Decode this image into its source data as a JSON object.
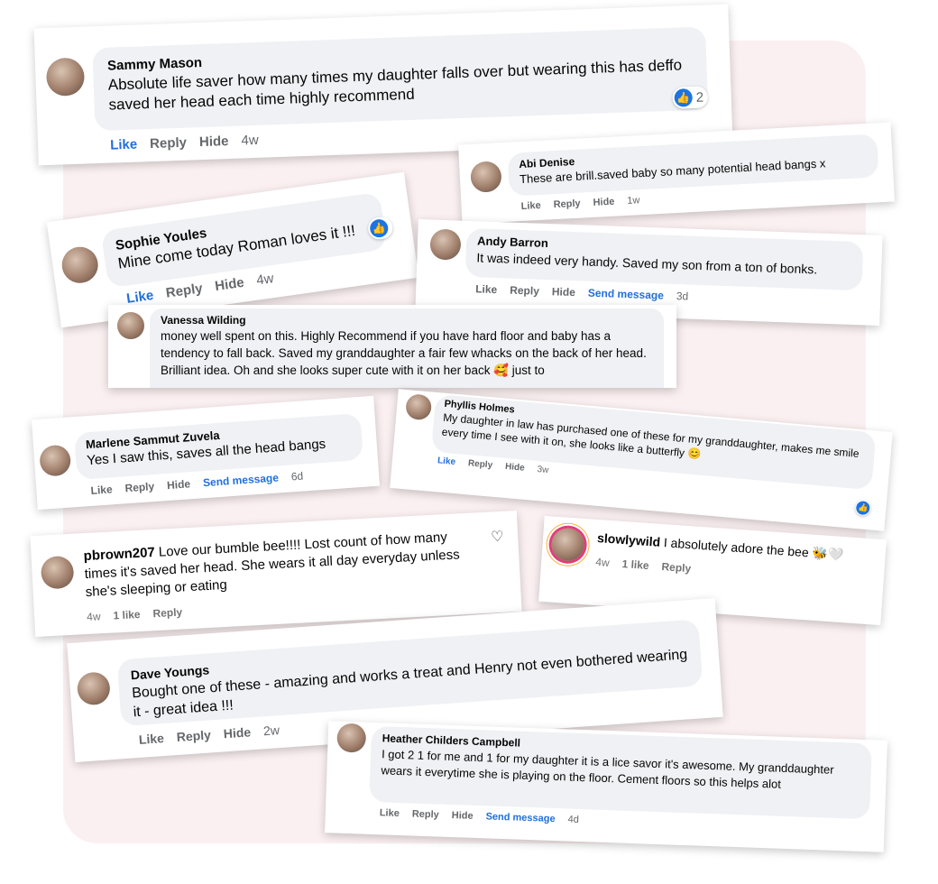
{
  "comments": [
    {
      "name": "Sammy Mason",
      "text": "Absolute life saver how many times my daughter falls over but wearing this has deffo saved her head each time highly recommend",
      "actions": [
        "Like",
        "Reply",
        "Hide"
      ],
      "time": "4w",
      "reactions": "2"
    },
    {
      "name": "Abi Denise",
      "text": "These are brill.saved baby so many potential head bangs x",
      "actions": [
        "Like",
        "Reply",
        "Hide"
      ],
      "time": "1w"
    },
    {
      "name": "Sophie Youles",
      "text": "Mine come today Roman loves it !!!",
      "actions": [
        "Like",
        "Reply",
        "Hide"
      ],
      "time": "4w"
    },
    {
      "name": "Andy Barron",
      "text": "It was indeed very handy. Saved my son from a ton of bonks.",
      "actions": [
        "Like",
        "Reply",
        "Hide",
        "Send message"
      ],
      "time": "3d"
    },
    {
      "name": "Vanessa Wilding",
      "text": "money well spent on this. Highly Recommend if you have hard floor and baby has a tendency to fall back. Saved my granddaughter a fair few whacks on the back of her head. Brilliant idea. Oh and she looks super cute with it on her back 🥰 just to"
    },
    {
      "name": "Marlene Sammut Zuvela",
      "text": "Yes I saw this, saves all the head bangs",
      "actions": [
        "Like",
        "Reply",
        "Hide",
        "Send message"
      ],
      "time": "6d"
    },
    {
      "name": "Phyllis Holmes",
      "text": "My daughter in law has purchased one of these for my granddaughter, makes me smile every time I see with it on, she looks like a butterfly 😊",
      "actions": [
        "Like",
        "Reply",
        "Hide"
      ],
      "time": "3w"
    },
    {
      "name": "pbrown207",
      "text": "Love our bumble bee!!!! Lost count of how many times it's saved her head. She wears it all day everyday unless she's sleeping or eating",
      "time": "4w",
      "likes": "1 like",
      "reply": "Reply"
    },
    {
      "name": "slowlywild",
      "text": "I absolutely adore the bee 🐝🤍",
      "time": "4w",
      "likes": "1 like",
      "reply": "Reply"
    },
    {
      "name": "Dave Youngs",
      "text": "Bought one of these - amazing and works a treat and Henry not even bothered wearing it - great idea !!!",
      "actions": [
        "Like",
        "Reply",
        "Hide"
      ],
      "time": "2w"
    },
    {
      "name": "Heather Childers Campbell",
      "text": "I got 2 1 for me and 1 for my daughter it is a lice savor it's awesome. My granddaughter wears it everytime she is playing on the floor. Cement floors so this helps alot",
      "actions": [
        "Like",
        "Reply",
        "Hide",
        "Send message"
      ],
      "time": "4d"
    }
  ],
  "icons": {
    "thumb": "thumbs-up-icon",
    "heart": "heart-icon"
  }
}
